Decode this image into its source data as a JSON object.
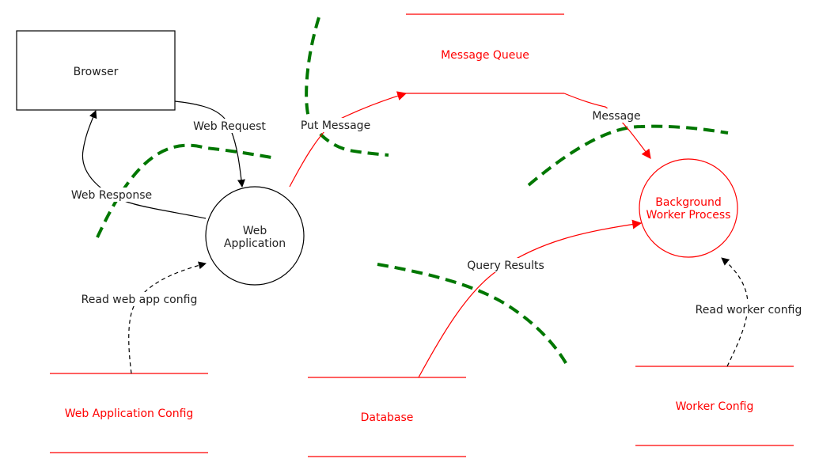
{
  "diagram": {
    "type": "data-flow-diagram",
    "colors": {
      "default": "#000000",
      "highlight": "#ff0000",
      "trust_boundary": "#007700",
      "background": "#ffffff"
    },
    "nodes": {
      "browser": {
        "label": "Browser",
        "kind": "external-entity"
      },
      "web_app": {
        "label_line1": "Web",
        "label_line2": "Application",
        "kind": "process"
      },
      "worker": {
        "label_line1": "Background",
        "label_line2": "Worker Process",
        "kind": "process",
        "highlighted": true
      },
      "message_queue": {
        "label": "Message Queue",
        "kind": "datastore",
        "highlighted": true
      },
      "database": {
        "label": "Database",
        "kind": "datastore",
        "highlighted": true
      },
      "web_app_config": {
        "label": "Web Application Config",
        "kind": "datastore",
        "highlighted": true
      },
      "worker_config": {
        "label": "Worker Config",
        "kind": "datastore",
        "highlighted": true
      }
    },
    "edges": {
      "web_request": {
        "label": "Web Request",
        "from": "Browser",
        "to": "Web Application",
        "style": "solid"
      },
      "web_response": {
        "label": "Web Response",
        "from": "Web Application",
        "to": "Browser",
        "style": "solid"
      },
      "put_message": {
        "label": "Put Message",
        "from": "Web Application",
        "to": "Message Queue",
        "style": "solid",
        "highlighted": true
      },
      "message": {
        "label": "Message",
        "from": "Message Queue",
        "to": "Background Worker Process",
        "style": "solid",
        "highlighted": true
      },
      "query_results": {
        "label": "Query Results",
        "from": "Database",
        "to": "Background Worker Process",
        "style": "solid",
        "highlighted": true
      },
      "read_web_app_config": {
        "label": "Read web app config",
        "from": "Web Application Config",
        "to": "Web Application",
        "style": "dashed"
      },
      "read_worker_config": {
        "label": "Read worker config",
        "from": "Worker Config",
        "to": "Background Worker Process",
        "style": "dashed"
      }
    },
    "trust_boundaries_count": 4
  }
}
